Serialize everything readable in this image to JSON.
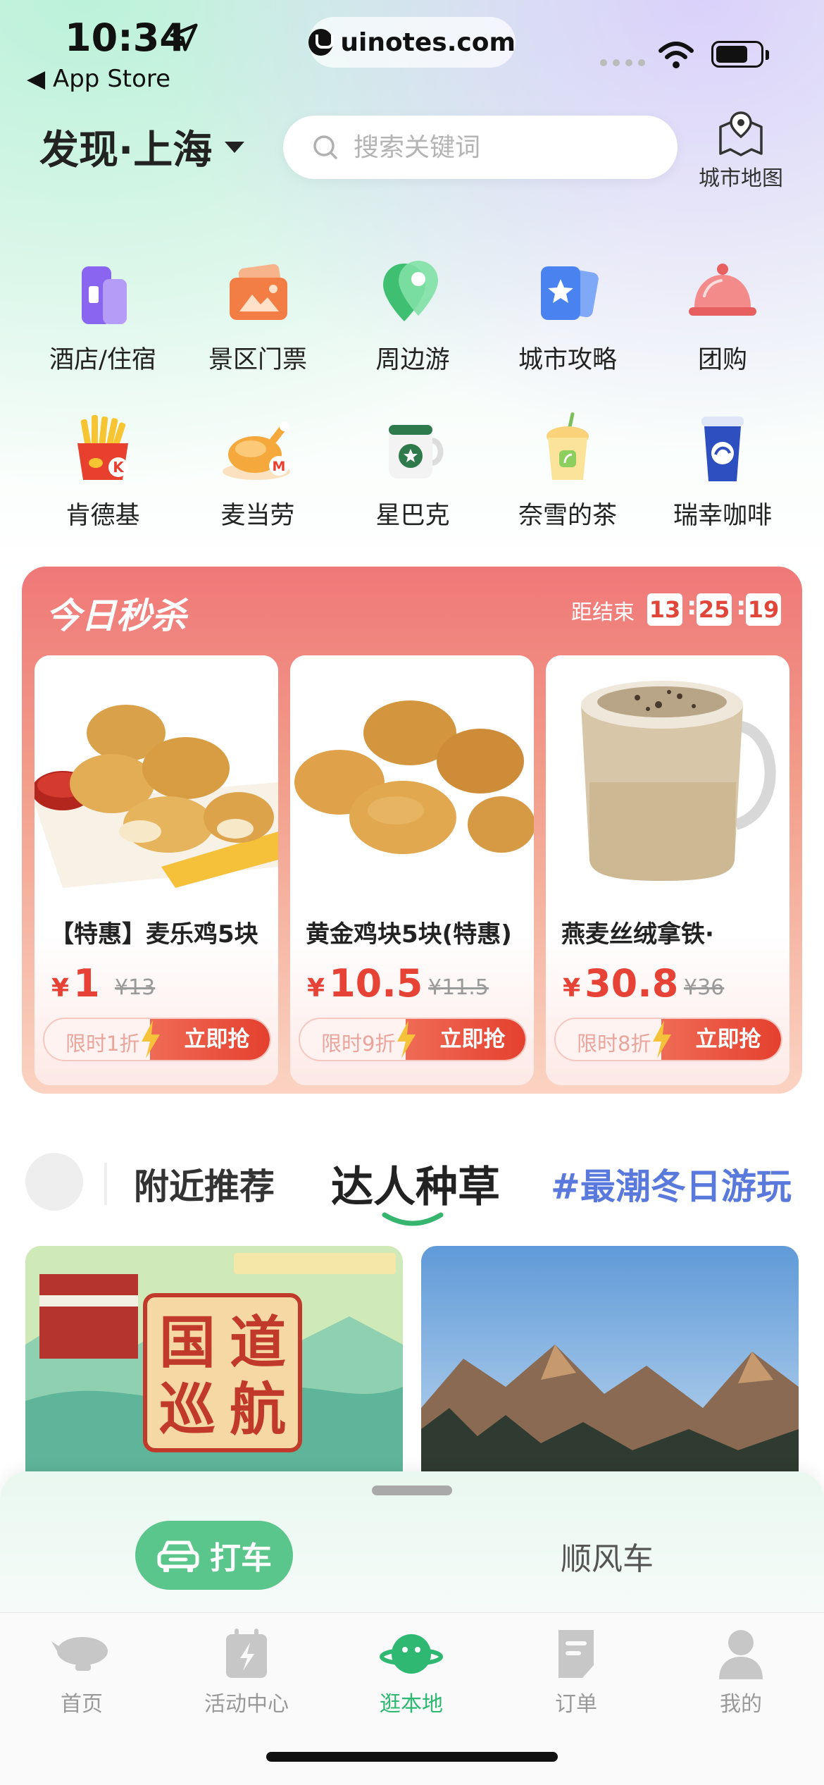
{
  "status_bar": {
    "time": "10:34",
    "back_label": "App Store",
    "url": "uinotes.com"
  },
  "header": {
    "city_title": "发现·上海",
    "search_placeholder": "搜索关键词",
    "map_label": "城市地图"
  },
  "categories": [
    {
      "label": "酒店/住宿",
      "icon": "hotel-icon"
    },
    {
      "label": "景区门票",
      "icon": "ticket-icon"
    },
    {
      "label": "周边游",
      "icon": "location-pin-icon"
    },
    {
      "label": "城市攻略",
      "icon": "guide-icon"
    },
    {
      "label": "团购",
      "icon": "cloche-icon"
    },
    {
      "label": "肯德基",
      "icon": "fries-icon"
    },
    {
      "label": "麦当劳",
      "icon": "chicken-icon"
    },
    {
      "label": "星巴克",
      "icon": "coffee-mug-icon"
    },
    {
      "label": "奈雪的茶",
      "icon": "tea-cup-icon"
    },
    {
      "label": "瑞幸咖啡",
      "icon": "luckin-cup-icon"
    }
  ],
  "flash_sale": {
    "title": "今日秒杀",
    "ends_label": "距结束",
    "countdown": {
      "hours": "13",
      "minutes": "25",
      "seconds": "19"
    },
    "products": [
      {
        "name": "【特惠】麦乐鸡5块",
        "currency": "¥",
        "price": "1",
        "original": "¥13",
        "discount": "限时1折",
        "buy": "立即抢"
      },
      {
        "name": "黄金鸡块5块(特惠)",
        "currency": "¥",
        "price": "10.5",
        "original": "¥11.5",
        "discount": "限时9折",
        "buy": "立即抢"
      },
      {
        "name": "燕麦丝绒拿铁·",
        "currency": "¥",
        "price": "30.8",
        "original": "¥36",
        "discount": "限时8折",
        "buy": "立即抢"
      }
    ]
  },
  "feed_tabs": [
    {
      "label": "附近推荐"
    },
    {
      "label": "达人种草",
      "active": true
    },
    {
      "label": "#最潮冬日游玩"
    }
  ],
  "ride": {
    "taxi": "打车",
    "carpool": "顺风车"
  },
  "tabbar": [
    {
      "label": "首页",
      "icon": "airship-icon"
    },
    {
      "label": "活动中心",
      "icon": "calendar-bolt-icon"
    },
    {
      "label": "逛本地",
      "icon": "planet-icon",
      "active": true
    },
    {
      "label": "订单",
      "icon": "order-note-icon"
    },
    {
      "label": "我的",
      "icon": "user-icon"
    }
  ],
  "colors": {
    "accent_green": "#5bc68b",
    "tab_active": "#2eb872",
    "sale_red": "#e64235",
    "hashtag_blue": "#5a79dc"
  }
}
